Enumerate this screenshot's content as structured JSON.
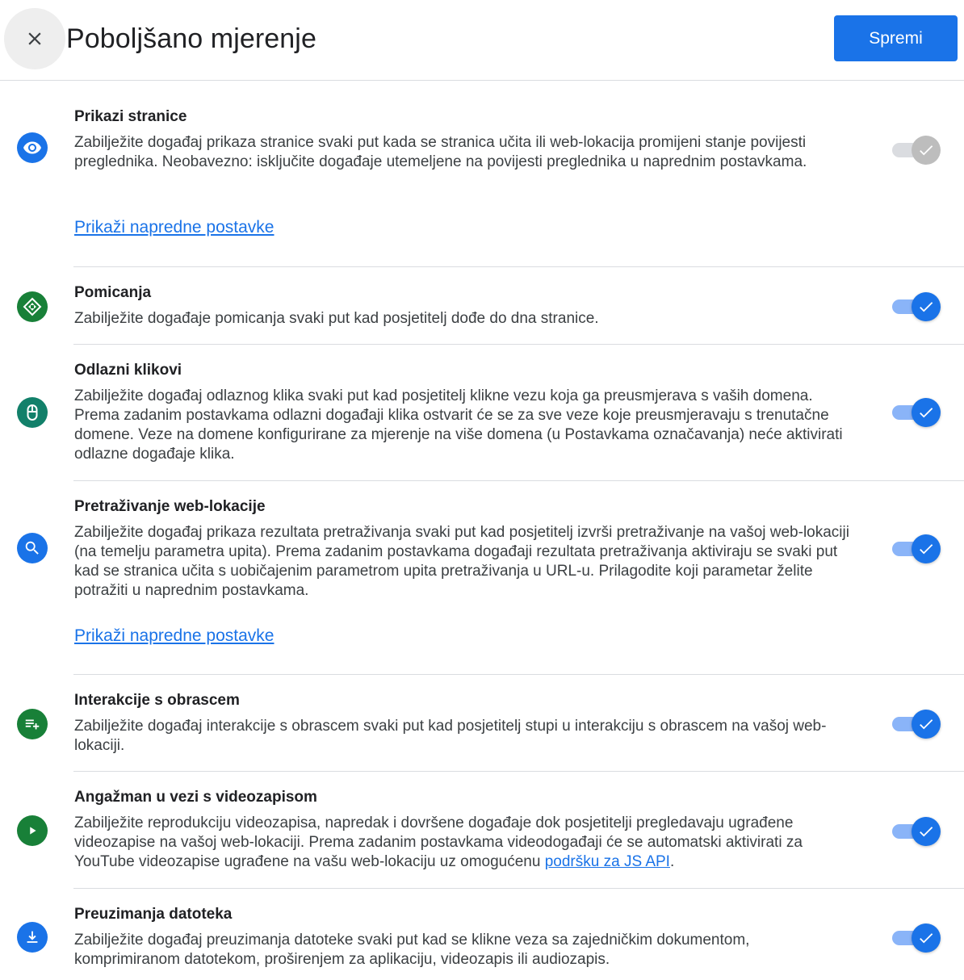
{
  "header": {
    "title": "Poboljšano mjerenje",
    "save_label": "Spremi"
  },
  "colors": {
    "accent": "#1a73e8",
    "icon_blue": "#1a73e8",
    "icon_green": "#188038",
    "icon_teal": "#12806a"
  },
  "sections": [
    {
      "title": "Prikazi stranice",
      "description": "Zabilježite događaj prikaza stranice svaki put kada se stranica učita ili web-lokacija promijeni stanje povijesti preglednika. Neobavezno: isključite događaje utemeljene na povijesti preglednika u naprednim postavkama.",
      "advanced_link": "Prikaži napredne postavke",
      "icon": "eye-icon",
      "enabled": true,
      "toggle_disabled": true
    },
    {
      "title": "Pomicanja",
      "description": "Zabilježite događaje pomicanja svaki put kad posjetitelj dođe do dna stranice.",
      "icon": "scroll-icon",
      "enabled": true
    },
    {
      "title": "Odlazni klikovi",
      "description": "Zabilježite događaj odlaznog klika svaki put kad posjetitelj klikne vezu koja ga preusmjerava s vaših domena. Prema zadanim postavkama odlazni događaji klika ostvarit će se za sve veze koje preusmjeravaju s trenutačne domene. Veze na domene konfigurirane za mjerenje na više domena (u Postavkama označavanja) neće aktivirati odlazne događaje klika.",
      "icon": "mouse-icon",
      "enabled": true
    },
    {
      "title": "Pretraživanje web-lokacije",
      "description": "Zabilježite događaj prikaza rezultata pretraživanja svaki put kad posjetitelj izvrši pretraživanje na vašoj web-lokaciji (na temelju parametra upita). Prema zadanim postavkama događaji rezultata pretraživanja aktiviraju se svaki put kad se stranica učita s uobičajenim parametrom upita pretraživanja u URL-u. Prilagodite koji parametar želite potražiti u naprednim postavkama.",
      "advanced_link": "Prikaži napredne postavke",
      "icon": "search-icon",
      "enabled": true
    },
    {
      "title": "Interakcije s obrascem",
      "description": "Zabilježite događaj interakcije s obrascem svaki put kad posjetitelj stupi u interakciju s obrascem na vašoj web-lokaciji.",
      "icon": "form-add-icon",
      "enabled": true
    },
    {
      "title": "Angažman u vezi s videozapisom",
      "description_before": "Zabilježite reprodukciju videozapisa, napredak i dovršene događaje dok posjetitelji pregledavaju ugrađene videozapise na vašoj web-lokaciji. Prema zadanim postavkama videodogađaji će se automatski aktivirati za YouTube videozapise ugrađene na vašu web-lokaciju uz omogućenu ",
      "description_link": "podršku za JS API",
      "description_after": ".",
      "icon": "play-icon",
      "enabled": true
    },
    {
      "title": "Preuzimanja datoteka",
      "description": "Zabilježite događaj preuzimanja datoteke svaki put kad se klikne veza sa zajedničkim dokumentom, komprimiranom datotekom, proširenjem za aplikaciju, videozapis ili audiozapis.",
      "icon": "download-icon",
      "enabled": true
    }
  ]
}
